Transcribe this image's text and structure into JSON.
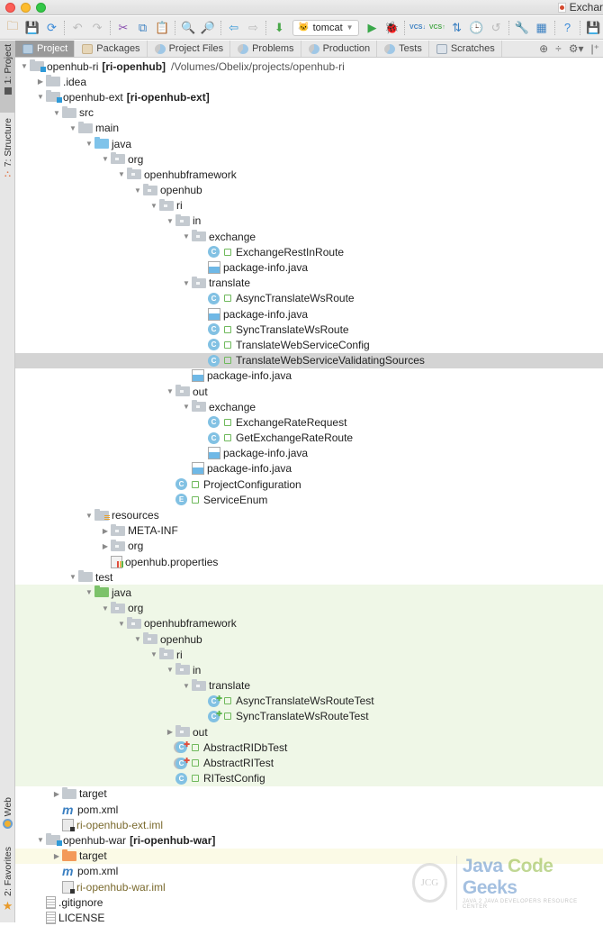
{
  "window": {
    "document_tab": "Exchar"
  },
  "toolbar": {
    "buttons": [
      {
        "name": "open-icon",
        "glyph": "🗀",
        "color": "#c48a3a"
      },
      {
        "name": "save-icon",
        "glyph": "💾",
        "color": "#777"
      },
      {
        "name": "sync-icon",
        "glyph": "⟳",
        "color": "#3a8ad8"
      },
      {
        "sep": true
      },
      {
        "name": "undo-icon",
        "glyph": "↶",
        "color": "#bbb"
      },
      {
        "name": "redo-icon",
        "glyph": "↷",
        "color": "#bbb"
      },
      {
        "sep": true
      },
      {
        "name": "cut-icon",
        "glyph": "✂",
        "color": "#8a4fb0"
      },
      {
        "name": "copy-icon",
        "glyph": "⧉",
        "color": "#3a7fc1"
      },
      {
        "name": "paste-icon",
        "glyph": "📋",
        "color": "#c4913a"
      },
      {
        "sep": true
      },
      {
        "name": "find-icon",
        "glyph": "🔍",
        "color": "#555"
      },
      {
        "name": "replace-icon",
        "glyph": "🔎",
        "color": "#555"
      },
      {
        "sep": true
      },
      {
        "name": "back-icon",
        "glyph": "⇦",
        "color": "#3a9ad8"
      },
      {
        "name": "forward-icon",
        "glyph": "⇨",
        "color": "#bbb"
      },
      {
        "sep": true
      },
      {
        "name": "make-project-icon",
        "glyph": "⬇",
        "color": "#4aa84a"
      }
    ],
    "run_config": {
      "label": "tomcat",
      "icon": "tomcat-icon"
    },
    "buttons_right": [
      {
        "name": "run-icon",
        "glyph": "▶",
        "color": "#3aa84a"
      },
      {
        "name": "debug-icon",
        "glyph": "🐞",
        "color": "#4aa84a"
      },
      {
        "sep": true
      },
      {
        "name": "vcs-update-icon",
        "glyph": "VCS↓",
        "color": "#3a7fc1"
      },
      {
        "name": "vcs-commit-icon",
        "glyph": "VCS↑",
        "color": "#4aa84a"
      },
      {
        "name": "compare-icon",
        "glyph": "⇅",
        "color": "#3a7fc1"
      },
      {
        "name": "history-icon",
        "glyph": "🕒",
        "color": "#3a7fc1"
      },
      {
        "name": "revert-icon",
        "glyph": "↺",
        "color": "#bbb"
      },
      {
        "sep": true
      },
      {
        "name": "settings-wrench-icon",
        "glyph": "🔧",
        "color": "#d8912e"
      },
      {
        "name": "project-structure-icon",
        "glyph": "▦",
        "color": "#3a7fc1"
      },
      {
        "sep": true
      },
      {
        "name": "help-icon",
        "glyph": "?",
        "color": "#3a8ad8"
      },
      {
        "sep": true
      },
      {
        "name": "save-green-icon",
        "glyph": "💾",
        "color": "#4aa84a"
      }
    ]
  },
  "side_tabs": {
    "project": "1: Project",
    "structure": "7: Structure",
    "web": "Web",
    "favorites": "2: Favorites"
  },
  "view_tabs": [
    {
      "label": "Project",
      "icon": "box",
      "active": true
    },
    {
      "label": "Packages",
      "icon": "pkg"
    },
    {
      "label": "Project Files",
      "icon": "pie"
    },
    {
      "label": "Problems",
      "icon": "pie"
    },
    {
      "label": "Production",
      "icon": "pie"
    },
    {
      "label": "Tests",
      "icon": "pie"
    },
    {
      "label": "Scratches",
      "icon": "scr"
    }
  ],
  "view_tools": [
    "⊕",
    "÷",
    "⚙▾",
    "|⁺"
  ],
  "tree": [
    {
      "d": 0,
      "a": "down",
      "i": "folder module",
      "t": "openhub-ri",
      "b": "[ri-openhub]",
      "p": "/Volumes/Obelix/projects/openhub-ri"
    },
    {
      "d": 1,
      "a": "right",
      "i": "folder",
      "t": ".idea"
    },
    {
      "d": 1,
      "a": "down",
      "i": "folder module",
      "t": "openhub-ext",
      "b": "[ri-openhub-ext]"
    },
    {
      "d": 2,
      "a": "down",
      "i": "folder",
      "t": "src"
    },
    {
      "d": 3,
      "a": "down",
      "i": "folder",
      "t": "main"
    },
    {
      "d": 4,
      "a": "down",
      "i": "folder src",
      "t": "java"
    },
    {
      "d": 5,
      "a": "down",
      "i": "folder pkg",
      "t": "org"
    },
    {
      "d": 6,
      "a": "down",
      "i": "folder pkg",
      "t": "openhubframework"
    },
    {
      "d": 7,
      "a": "down",
      "i": "folder pkg",
      "t": "openhub"
    },
    {
      "d": 8,
      "a": "down",
      "i": "folder pkg",
      "t": "ri"
    },
    {
      "d": 9,
      "a": "down",
      "i": "folder pkg",
      "t": "in"
    },
    {
      "d": 10,
      "a": "down",
      "i": "folder pkg",
      "t": "exchange"
    },
    {
      "d": 11,
      "a": "none",
      "i": "cls",
      "c": "C",
      "lock": true,
      "t": "ExchangeRestInRoute"
    },
    {
      "d": 11,
      "a": "none",
      "i": "jfile",
      "t": "package-info.java"
    },
    {
      "d": 10,
      "a": "down",
      "i": "folder pkg",
      "t": "translate"
    },
    {
      "d": 11,
      "a": "none",
      "i": "cls",
      "c": "C",
      "lock": true,
      "t": "AsyncTranslateWsRoute"
    },
    {
      "d": 11,
      "a": "none",
      "i": "jfile",
      "t": "package-info.java"
    },
    {
      "d": 11,
      "a": "none",
      "i": "cls",
      "c": "C",
      "lock": true,
      "t": "SyncTranslateWsRoute"
    },
    {
      "d": 11,
      "a": "none",
      "i": "cls",
      "c": "C",
      "lock": true,
      "t": "TranslateWebServiceConfig"
    },
    {
      "d": 11,
      "a": "none",
      "i": "cls",
      "c": "C",
      "lock": true,
      "t": "TranslateWebServiceValidatingSources",
      "sel": true
    },
    {
      "d": 10,
      "a": "none",
      "i": "jfile",
      "t": "package-info.java"
    },
    {
      "d": 9,
      "a": "down",
      "i": "folder pkg",
      "t": "out"
    },
    {
      "d": 10,
      "a": "down",
      "i": "folder pkg",
      "t": "exchange"
    },
    {
      "d": 11,
      "a": "none",
      "i": "cls",
      "c": "C",
      "lock": true,
      "t": "ExchangeRateRequest"
    },
    {
      "d": 11,
      "a": "none",
      "i": "cls",
      "c": "C",
      "lock": true,
      "t": "GetExchangeRateRoute"
    },
    {
      "d": 11,
      "a": "none",
      "i": "jfile",
      "t": "package-info.java"
    },
    {
      "d": 10,
      "a": "none",
      "i": "jfile",
      "t": "package-info.java"
    },
    {
      "d": 9,
      "a": "none",
      "i": "cls",
      "c": "C",
      "lock": true,
      "t": "ProjectConfiguration"
    },
    {
      "d": 9,
      "a": "none",
      "i": "cls",
      "c": "E",
      "lock": true,
      "t": "ServiceEnum"
    },
    {
      "d": 4,
      "a": "down",
      "i": "folder res",
      "t": "resources"
    },
    {
      "d": 5,
      "a": "right",
      "i": "folder pkg",
      "t": "META-INF"
    },
    {
      "d": 5,
      "a": "right",
      "i": "folder pkg",
      "t": "org"
    },
    {
      "d": 5,
      "a": "none",
      "i": "propfile",
      "t": "openhub.properties"
    },
    {
      "d": 3,
      "a": "down",
      "i": "folder",
      "t": "test"
    },
    {
      "d": 4,
      "a": "down",
      "i": "folder test",
      "t": "java",
      "test": true
    },
    {
      "d": 5,
      "a": "down",
      "i": "folder pkg",
      "t": "org",
      "test": true
    },
    {
      "d": 6,
      "a": "down",
      "i": "folder pkg",
      "t": "openhubframework",
      "test": true
    },
    {
      "d": 7,
      "a": "down",
      "i": "folder pkg",
      "t": "openhub",
      "test": true
    },
    {
      "d": 8,
      "a": "down",
      "i": "folder pkg",
      "t": "ri",
      "test": true
    },
    {
      "d": 9,
      "a": "down",
      "i": "folder pkg",
      "t": "in",
      "test": true
    },
    {
      "d": 10,
      "a": "down",
      "i": "folder pkg",
      "t": "translate",
      "test": true
    },
    {
      "d": 11,
      "a": "none",
      "i": "cls",
      "c": "C",
      "tm": "green",
      "lock": true,
      "t": "AsyncTranslateWsRouteTest",
      "test": true
    },
    {
      "d": 11,
      "a": "none",
      "i": "cls",
      "c": "C",
      "tm": "green",
      "lock": true,
      "t": "SyncTranslateWsRouteTest",
      "test": true
    },
    {
      "d": 9,
      "a": "right",
      "i": "folder pkg",
      "t": "out",
      "test": true
    },
    {
      "d": 9,
      "a": "none",
      "i": "cls abstract",
      "c": "C",
      "tm": "red",
      "lock": true,
      "t": "AbstractRIDbTest",
      "test": true
    },
    {
      "d": 9,
      "a": "none",
      "i": "cls abstract",
      "c": "C",
      "tm": "red",
      "lock": true,
      "t": "AbstractRITest",
      "test": true
    },
    {
      "d": 9,
      "a": "none",
      "i": "cls",
      "c": "C",
      "lock": true,
      "t": "RITestConfig",
      "test": true
    },
    {
      "d": 2,
      "a": "right",
      "i": "folder",
      "t": "target"
    },
    {
      "d": 2,
      "a": "none",
      "i": "mfile",
      "t": "pom.xml"
    },
    {
      "d": 2,
      "a": "none",
      "i": "imlfile",
      "t": "ri-openhub-ext.iml",
      "iml": true
    },
    {
      "d": 1,
      "a": "down",
      "i": "folder module",
      "t": "openhub-war",
      "b": "[ri-openhub-war]"
    },
    {
      "d": 2,
      "a": "right",
      "i": "folder excl",
      "t": "target",
      "excl": true
    },
    {
      "d": 2,
      "a": "none",
      "i": "mfile",
      "t": "pom.xml"
    },
    {
      "d": 2,
      "a": "none",
      "i": "imlfile",
      "t": "ri-openhub-war.iml",
      "iml": true
    },
    {
      "d": 1,
      "a": "none",
      "i": "txtfile",
      "t": ".gitignore"
    },
    {
      "d": 1,
      "a": "none",
      "i": "txtfile",
      "t": "LICENSE"
    }
  ],
  "watermark": {
    "logo": "JCG",
    "title_a": "Java ",
    "title_b": "Code",
    "title_c": " Geeks",
    "subtitle": "JAVA 2 JAVA DEVELOPERS RESOURCE CENTER"
  }
}
